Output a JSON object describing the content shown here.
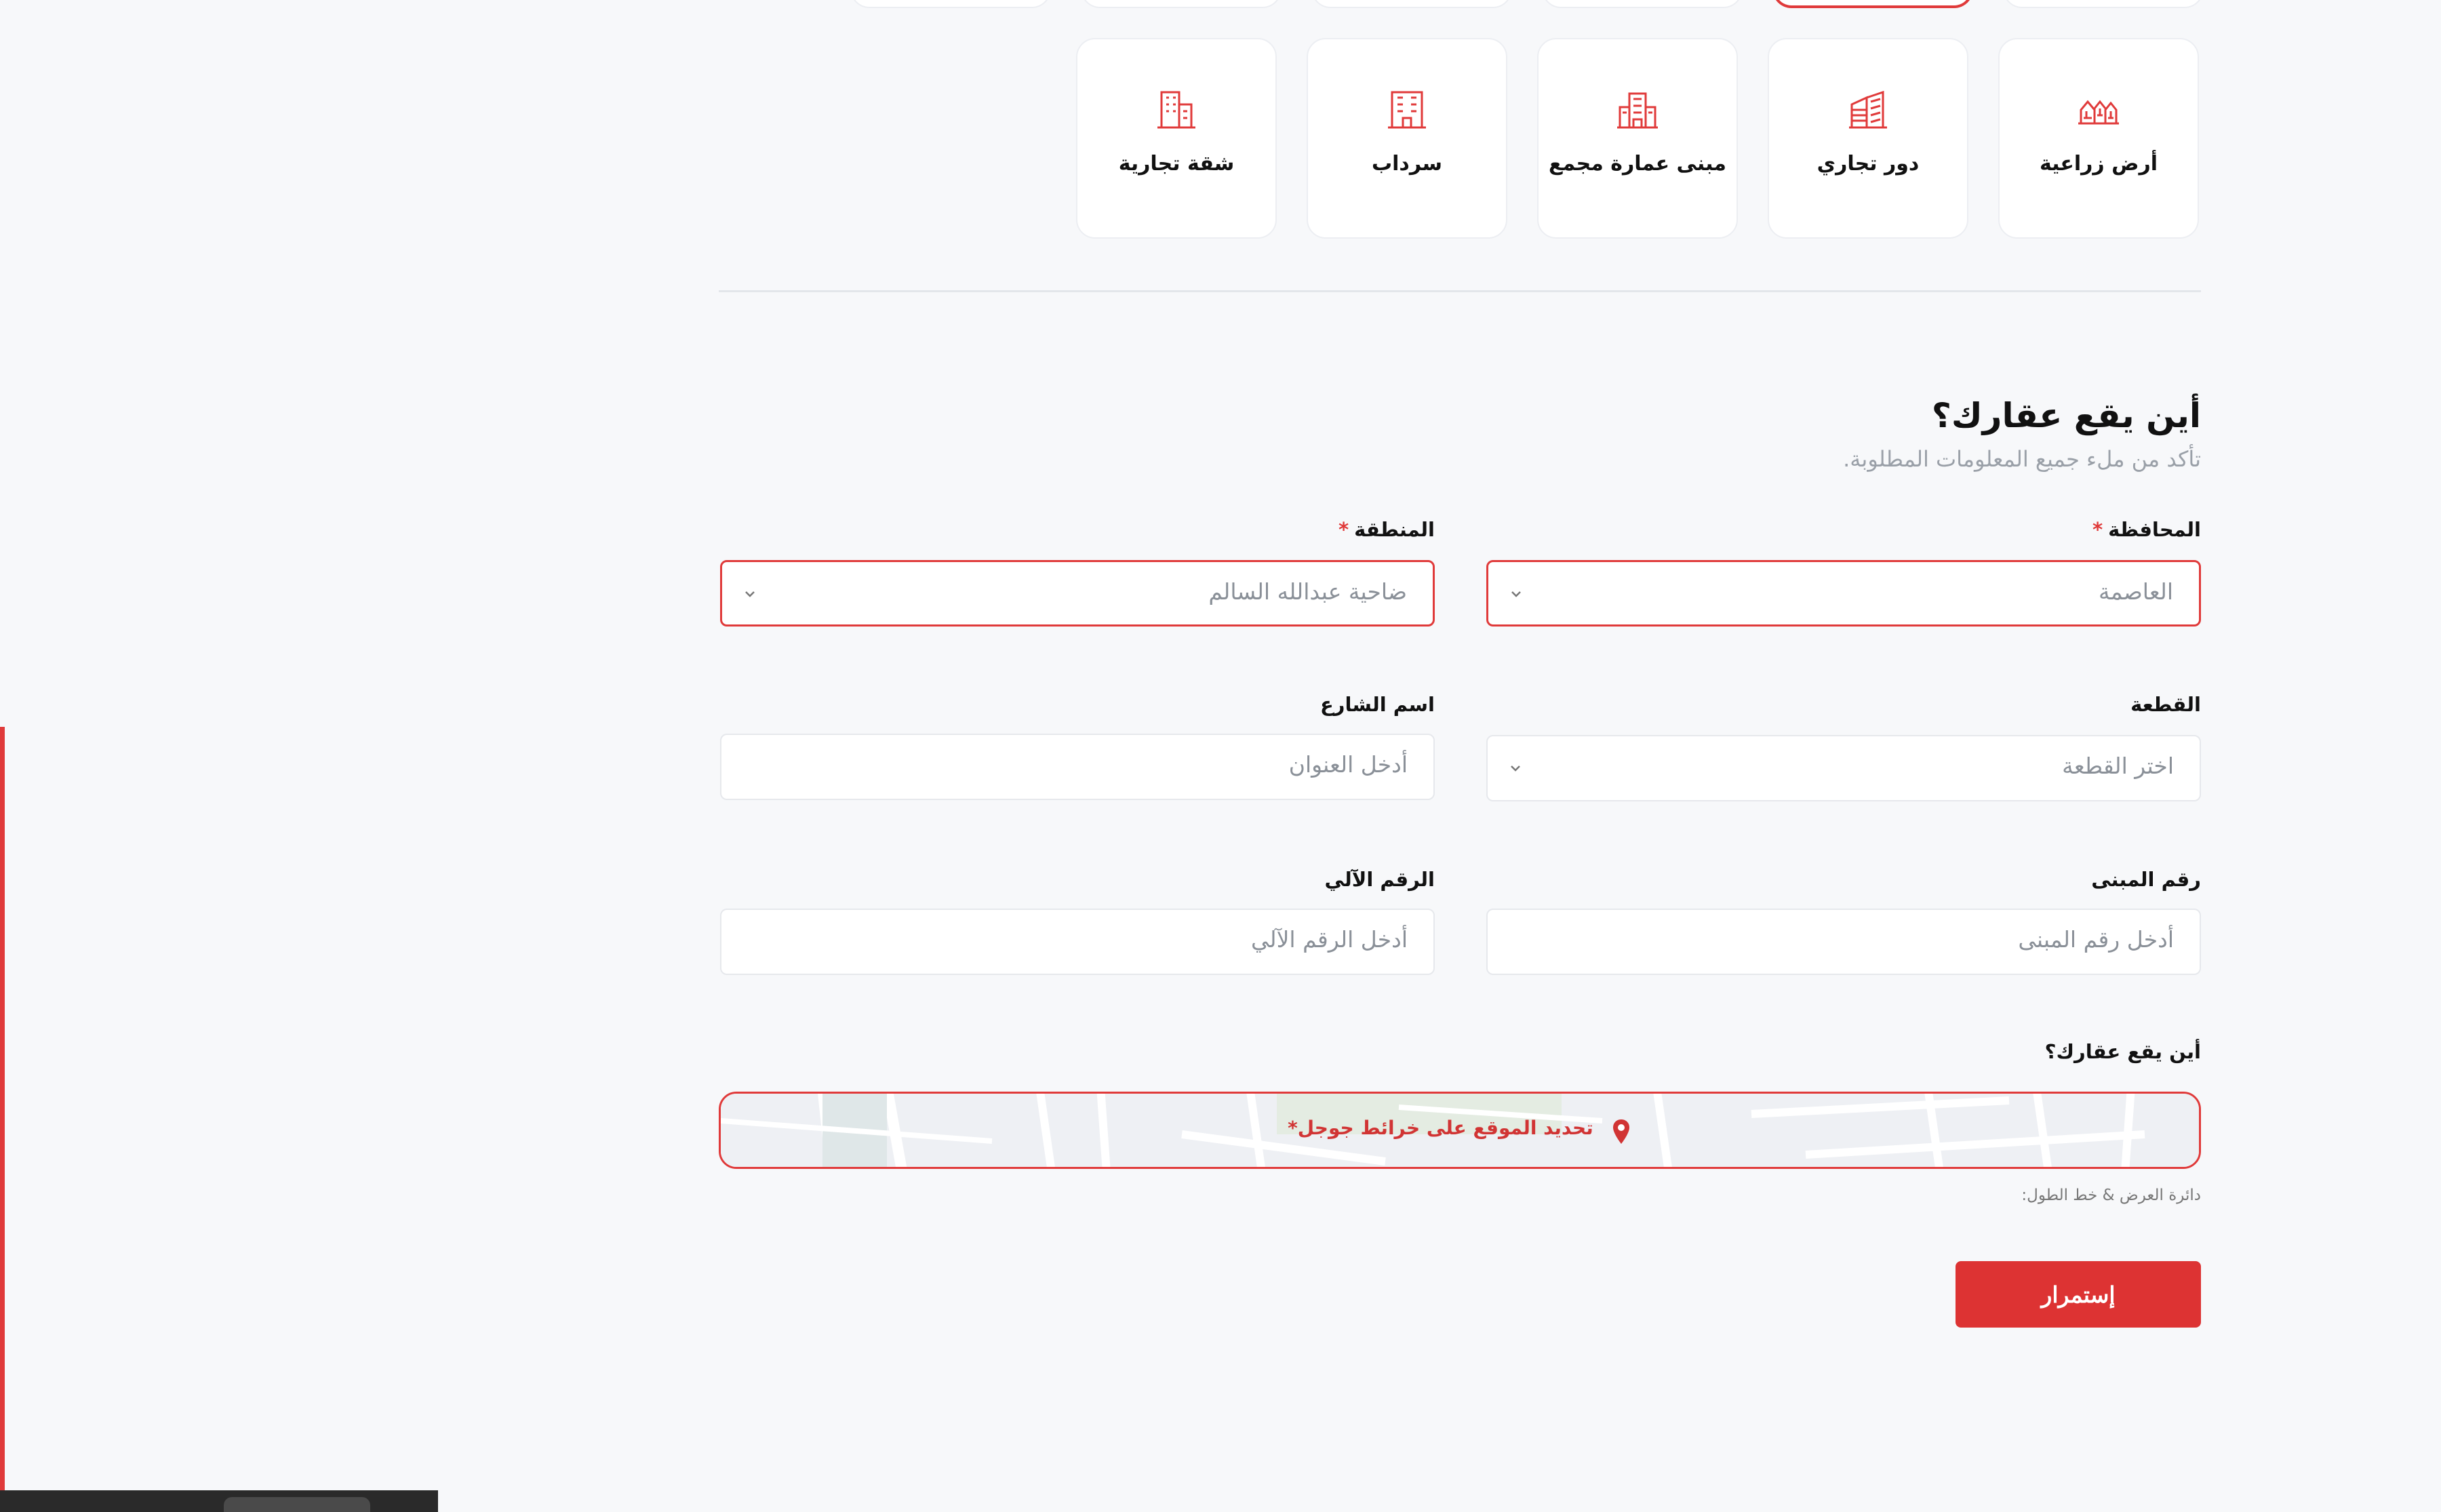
{
  "property_types": [
    {
      "label": "شقة تجارية",
      "icon": "office-apartment-icon"
    },
    {
      "label": "سرداب",
      "icon": "basement-building-icon"
    },
    {
      "label": "مبنى عمارة مجمع",
      "icon": "complex-building-icon"
    },
    {
      "label": "دور تجاري",
      "icon": "commercial-floor-icon"
    },
    {
      "label": "أرض زراعية",
      "icon": "farm-land-icon"
    }
  ],
  "section": {
    "title": "أين يقع عقارك؟",
    "subtitle": "تأكد من ملء جميع المعلومات المطلوبة."
  },
  "fields": {
    "governorate": {
      "label": "المحافظة",
      "value": "العاصمة",
      "required": "*"
    },
    "area": {
      "label": "المنطقة",
      "value": "ضاحية عبدالله السالم",
      "required": "*"
    },
    "block": {
      "label": "القطعة",
      "placeholder": "اختر القطعة"
    },
    "street": {
      "label": "اسم الشارع",
      "placeholder": "أدخل العنوان"
    },
    "building": {
      "label": "رقم المبنى",
      "placeholder": "أدخل رقم المبنى"
    },
    "auto_number": {
      "label": "الرقم الآلي",
      "placeholder": "أدخل الرقم الآلي"
    }
  },
  "map": {
    "label": "أين يقع عقارك؟",
    "cta": "تحديد الموقع على خرائط جوجل*",
    "coords_label": "دائرة العرض & خط الطول:"
  },
  "continue_button": "إستمرار",
  "colors": {
    "accent": "#e03a3a",
    "background": "#f7f8fa"
  }
}
